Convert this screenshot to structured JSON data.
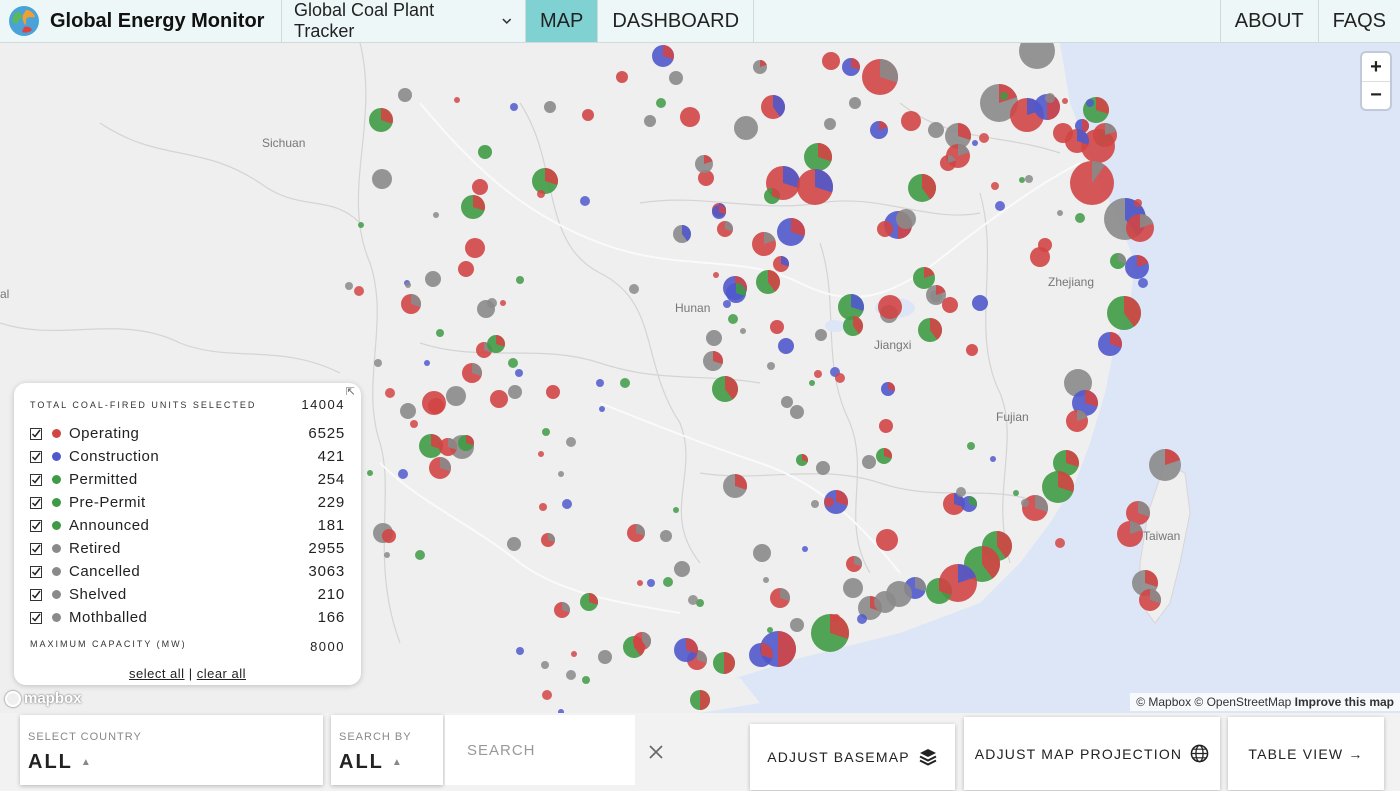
{
  "brand": {
    "name": "Global Energy Monitor"
  },
  "nav": {
    "tracker_label": "Global Coal Plant Tracker",
    "tabs": [
      {
        "label": "MAP",
        "active": true
      },
      {
        "label": "DASHBOARD",
        "active": false
      }
    ],
    "right_tabs": [
      {
        "label": "ABOUT"
      },
      {
        "label": "FAQS"
      }
    ]
  },
  "map": {
    "place_labels": [
      "Sichuan",
      "Hunan",
      "Jiangxi",
      "Zhejiang",
      "Fujian",
      "Taiwan",
      "al"
    ],
    "zoom_in": "+",
    "zoom_out": "−",
    "attribution": {
      "text": "© Mapbox © OpenStreetMap",
      "improve": "Improve this map"
    },
    "logo": "mapbox",
    "colors": {
      "operating": "#d24545",
      "construction": "#5059cc",
      "planned": "#3f9a45",
      "inactive": "#8a8a8a"
    }
  },
  "legend": {
    "total_label": "TOTAL COAL-FIRED UNITS SELECTED",
    "total_value": "14004",
    "items": [
      {
        "name": "Operating",
        "value": "6525",
        "color": "#d24545"
      },
      {
        "name": "Construction",
        "value": "421",
        "color": "#5059cc"
      },
      {
        "name": "Permitted",
        "value": "254",
        "color": "#3f9a45"
      },
      {
        "name": "Pre-Permit",
        "value": "229",
        "color": "#3f9a45"
      },
      {
        "name": "Announced",
        "value": "181",
        "color": "#3f9a45"
      },
      {
        "name": "Retired",
        "value": "2955",
        "color": "#8a8a8a"
      },
      {
        "name": "Cancelled",
        "value": "3063",
        "color": "#8a8a8a"
      },
      {
        "name": "Shelved",
        "value": "210",
        "color": "#8a8a8a"
      },
      {
        "name": "Mothballed",
        "value": "166",
        "color": "#8a8a8a"
      }
    ],
    "max_capacity_label": "MAXIMUM CAPACITY (MW)",
    "max_capacity_value": "8000",
    "select_all": "select all",
    "separator": "|",
    "clear_all": "clear all"
  },
  "bottombar": {
    "select_country_label": "SELECT COUNTRY",
    "select_country_value": "ALL",
    "search_by_label": "SEARCH BY",
    "search_by_value": "ALL",
    "search_placeholder": "SEARCH",
    "adjust_basemap": "ADJUST BASEMAP",
    "adjust_projection": "ADJUST MAP PROJECTION",
    "table_view": "TABLE VIEW →"
  }
}
